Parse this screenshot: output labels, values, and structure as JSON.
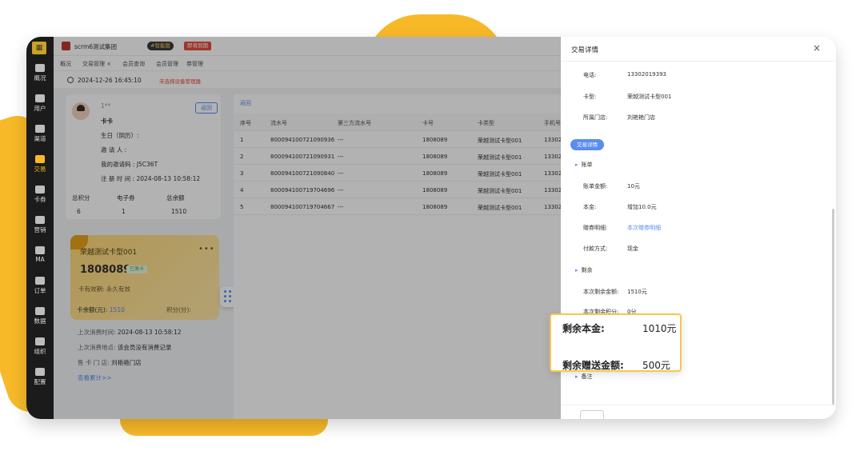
{
  "sidebar": {
    "items": [
      {
        "label": "概况"
      },
      {
        "label": "用户"
      },
      {
        "label": "渠道"
      },
      {
        "label": "交易"
      },
      {
        "label": "卡券"
      },
      {
        "label": "营销"
      },
      {
        "label": "MA"
      },
      {
        "label": "订单"
      },
      {
        "label": "数据"
      },
      {
        "label": "组织"
      },
      {
        "label": "配置"
      }
    ],
    "active_index": 3
  },
  "topbar": {
    "brand": "scrm6测试集团",
    "vip": "#智能版",
    "renew": "即将到期"
  },
  "tabs": [
    "概况",
    "交易管理 ×",
    "会员查询",
    "会员管理",
    "券管理"
  ],
  "timebar": {
    "time": "2024-12-26 16:45:10",
    "warning": "未选择设备管理器"
  },
  "customer": {
    "phone": "1**",
    "name": "卡卡",
    "back_label": "返回",
    "birthday_label": "生日（阴历）:",
    "inviter_label": "邀 请 人 :",
    "my_code_label": "我的邀请码 :",
    "my_code": "J5C36T",
    "register_label": "注 册 时 间 :",
    "register_time": "2024-08-13 10:58:12",
    "stats": [
      {
        "label": "总积分",
        "value": "6"
      },
      {
        "label": "电子券",
        "value": "1"
      },
      {
        "label": "总余额",
        "value": "1510"
      }
    ]
  },
  "member_card": {
    "title": "荣越测试卡型001",
    "more": "•••",
    "number": "1808089",
    "status": "已激卡",
    "valid_label": "卡有效期:",
    "valid_value": "永久有效",
    "balance_label": "卡余额(元):",
    "balance_value": "1510",
    "points_label": "积分(分):"
  },
  "last_info": {
    "time_label": "上次消费时间:",
    "time_value": "2024-08-13 10:58:12",
    "place_label": "上次消费地点:",
    "place_value": "该会员没有消费记录",
    "store_label": "售 卡 门 店:",
    "store_value": "刘艳艳门店",
    "link": "查看累计>>"
  },
  "table": {
    "back": "返回",
    "headers": [
      "序号",
      "流水号",
      "第三方流水号",
      "卡号",
      "卡类型",
      "手机号"
    ],
    "rows": [
      [
        "1",
        "800094100721090936",
        "---",
        "1808089",
        "荣越测试卡型001",
        "13302"
      ],
      [
        "2",
        "800094100721090931",
        "---",
        "1808089",
        "荣越测试卡型001",
        "13302"
      ],
      [
        "3",
        "800094100721090840",
        "---",
        "1808089",
        "荣越测试卡型001",
        "13302"
      ],
      [
        "4",
        "800094100719704696",
        "---",
        "1808089",
        "荣越测试卡型001",
        "13302"
      ],
      [
        "5",
        "800094100719704667",
        "---",
        "1808089",
        "荣越测试卡型001",
        "13302"
      ]
    ]
  },
  "drawer": {
    "title": "交易详情",
    "close": "×",
    "phone_label": "电话:",
    "phone_value": "13302019393",
    "card_type_label": "卡型:",
    "card_type_value": "荣越测试卡型001",
    "store_label": "所属门店:",
    "store_value": "刘艳艳门店",
    "pill": "交易详情",
    "section_bill": "账单",
    "bill_amount_label": "账单金额:",
    "bill_amount_value": "10元",
    "principal_label": "本金:",
    "principal_value": "增加10.0元",
    "coupon_label": "赠券明细:",
    "coupon_value": "本次赠券明细",
    "pay_label": "付款方式:",
    "pay_value": "现金",
    "section_remain": "剩余",
    "remain_amount_label": "本次剩余金额:",
    "remain_amount_value": "1510元",
    "remain_points_label": "本次剩余积分:",
    "remain_points_value": "0分",
    "section_note": "备注"
  },
  "callout": {
    "principal_label": "剩余本金:",
    "principal_value": "1010元",
    "gift_label": "剩余赠送金额:",
    "gift_value": "500元"
  },
  "colors": {
    "accent_yellow": "#f7b928",
    "link_blue": "#5b8def",
    "sidebar_bg": "#1b1b1b"
  }
}
